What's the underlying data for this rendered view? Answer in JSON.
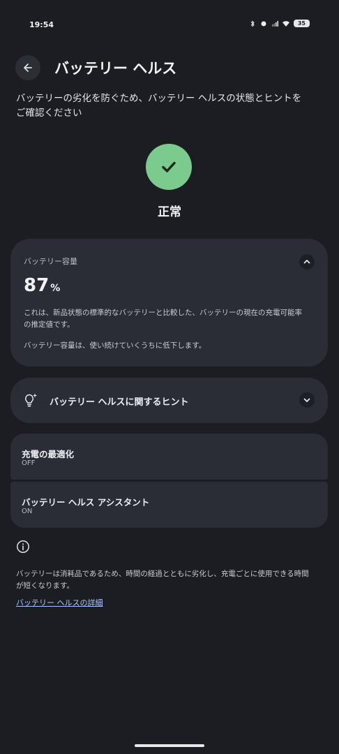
{
  "status_bar": {
    "time": "19:54",
    "battery_level": "35",
    "icons": [
      "bluetooth-icon",
      "dot-icon",
      "signal-icon",
      "wifi-icon",
      "battery-icon"
    ]
  },
  "header": {
    "back_icon": "arrow-left-icon",
    "title": "バッテリー ヘルス"
  },
  "description": "バッテリーの劣化を防ぐため、バッテリー ヘルスの状態とヒントをご確認ください",
  "health_status": {
    "icon": "check-icon",
    "color": "#7acb8d",
    "label": "正常"
  },
  "capacity_card": {
    "label": "バッテリー容量",
    "value": "87",
    "unit": "%",
    "description": "これは、新品状態の標準的なバッテリーと比較した、バッテリーの現在の充電可能率の推定値です。",
    "note": "バッテリー容量は、使い続けていくうちに低下します。",
    "toggle_icon": "chevron-up-icon"
  },
  "hints_card": {
    "icon": "lightbulb-sparkle-icon",
    "label": "バッテリー ヘルスに関するヒント",
    "toggle_icon": "chevron-down-icon"
  },
  "settings": [
    {
      "title": "充電の最適化",
      "value": "OFF"
    },
    {
      "title": "バッテリー ヘルス アシスタント",
      "value": "ON"
    }
  ],
  "footer": {
    "info_icon": "info-icon",
    "text": "バッテリーは消耗品であるため、時間の経過とともに劣化し、充電ごとに使用できる時間が短くなります。",
    "link": "バッテリー ヘルスの詳細"
  }
}
